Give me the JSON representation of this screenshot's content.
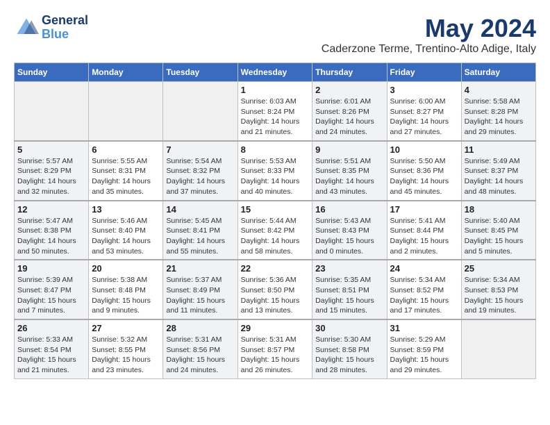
{
  "header": {
    "logo_line1": "General",
    "logo_line2": "Blue",
    "month": "May 2024",
    "subtitle": "Caderzone Terme, Trentino-Alto Adige, Italy"
  },
  "weekdays": [
    "Sunday",
    "Monday",
    "Tuesday",
    "Wednesday",
    "Thursday",
    "Friday",
    "Saturday"
  ],
  "weeks": [
    [
      {
        "day": "",
        "info": ""
      },
      {
        "day": "",
        "info": ""
      },
      {
        "day": "",
        "info": ""
      },
      {
        "day": "1",
        "info": "Sunrise: 6:03 AM\nSunset: 8:24 PM\nDaylight: 14 hours\nand 21 minutes."
      },
      {
        "day": "2",
        "info": "Sunrise: 6:01 AM\nSunset: 8:26 PM\nDaylight: 14 hours\nand 24 minutes."
      },
      {
        "day": "3",
        "info": "Sunrise: 6:00 AM\nSunset: 8:27 PM\nDaylight: 14 hours\nand 27 minutes."
      },
      {
        "day": "4",
        "info": "Sunrise: 5:58 AM\nSunset: 8:28 PM\nDaylight: 14 hours\nand 29 minutes."
      }
    ],
    [
      {
        "day": "5",
        "info": "Sunrise: 5:57 AM\nSunset: 8:29 PM\nDaylight: 14 hours\nand 32 minutes."
      },
      {
        "day": "6",
        "info": "Sunrise: 5:55 AM\nSunset: 8:31 PM\nDaylight: 14 hours\nand 35 minutes."
      },
      {
        "day": "7",
        "info": "Sunrise: 5:54 AM\nSunset: 8:32 PM\nDaylight: 14 hours\nand 37 minutes."
      },
      {
        "day": "8",
        "info": "Sunrise: 5:53 AM\nSunset: 8:33 PM\nDaylight: 14 hours\nand 40 minutes."
      },
      {
        "day": "9",
        "info": "Sunrise: 5:51 AM\nSunset: 8:35 PM\nDaylight: 14 hours\nand 43 minutes."
      },
      {
        "day": "10",
        "info": "Sunrise: 5:50 AM\nSunset: 8:36 PM\nDaylight: 14 hours\nand 45 minutes."
      },
      {
        "day": "11",
        "info": "Sunrise: 5:49 AM\nSunset: 8:37 PM\nDaylight: 14 hours\nand 48 minutes."
      }
    ],
    [
      {
        "day": "12",
        "info": "Sunrise: 5:47 AM\nSunset: 8:38 PM\nDaylight: 14 hours\nand 50 minutes."
      },
      {
        "day": "13",
        "info": "Sunrise: 5:46 AM\nSunset: 8:40 PM\nDaylight: 14 hours\nand 53 minutes."
      },
      {
        "day": "14",
        "info": "Sunrise: 5:45 AM\nSunset: 8:41 PM\nDaylight: 14 hours\nand 55 minutes."
      },
      {
        "day": "15",
        "info": "Sunrise: 5:44 AM\nSunset: 8:42 PM\nDaylight: 14 hours\nand 58 minutes."
      },
      {
        "day": "16",
        "info": "Sunrise: 5:43 AM\nSunset: 8:43 PM\nDaylight: 15 hours\nand 0 minutes."
      },
      {
        "day": "17",
        "info": "Sunrise: 5:41 AM\nSunset: 8:44 PM\nDaylight: 15 hours\nand 2 minutes."
      },
      {
        "day": "18",
        "info": "Sunrise: 5:40 AM\nSunset: 8:45 PM\nDaylight: 15 hours\nand 5 minutes."
      }
    ],
    [
      {
        "day": "19",
        "info": "Sunrise: 5:39 AM\nSunset: 8:47 PM\nDaylight: 15 hours\nand 7 minutes."
      },
      {
        "day": "20",
        "info": "Sunrise: 5:38 AM\nSunset: 8:48 PM\nDaylight: 15 hours\nand 9 minutes."
      },
      {
        "day": "21",
        "info": "Sunrise: 5:37 AM\nSunset: 8:49 PM\nDaylight: 15 hours\nand 11 minutes."
      },
      {
        "day": "22",
        "info": "Sunrise: 5:36 AM\nSunset: 8:50 PM\nDaylight: 15 hours\nand 13 minutes."
      },
      {
        "day": "23",
        "info": "Sunrise: 5:35 AM\nSunset: 8:51 PM\nDaylight: 15 hours\nand 15 minutes."
      },
      {
        "day": "24",
        "info": "Sunrise: 5:34 AM\nSunset: 8:52 PM\nDaylight: 15 hours\nand 17 minutes."
      },
      {
        "day": "25",
        "info": "Sunrise: 5:34 AM\nSunset: 8:53 PM\nDaylight: 15 hours\nand 19 minutes."
      }
    ],
    [
      {
        "day": "26",
        "info": "Sunrise: 5:33 AM\nSunset: 8:54 PM\nDaylight: 15 hours\nand 21 minutes."
      },
      {
        "day": "27",
        "info": "Sunrise: 5:32 AM\nSunset: 8:55 PM\nDaylight: 15 hours\nand 23 minutes."
      },
      {
        "day": "28",
        "info": "Sunrise: 5:31 AM\nSunset: 8:56 PM\nDaylight: 15 hours\nand 24 minutes."
      },
      {
        "day": "29",
        "info": "Sunrise: 5:31 AM\nSunset: 8:57 PM\nDaylight: 15 hours\nand 26 minutes."
      },
      {
        "day": "30",
        "info": "Sunrise: 5:30 AM\nSunset: 8:58 PM\nDaylight: 15 hours\nand 28 minutes."
      },
      {
        "day": "31",
        "info": "Sunrise: 5:29 AM\nSunset: 8:59 PM\nDaylight: 15 hours\nand 29 minutes."
      },
      {
        "day": "",
        "info": ""
      }
    ]
  ]
}
